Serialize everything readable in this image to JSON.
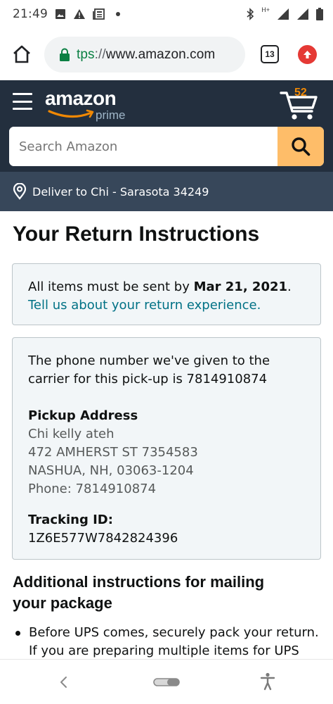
{
  "status_bar": {
    "time": "21:49",
    "left_icons": [
      "image-icon",
      "warning-icon",
      "news-icon",
      "dot-icon"
    ],
    "right_icons": [
      "bluetooth-icon",
      "hplus-signal-icon",
      "signal-icon",
      "battery-icon"
    ],
    "network_label": "H+"
  },
  "browser": {
    "url_scheme": "tps",
    "url_separator": "://",
    "url_host": "www.amazon.com",
    "tab_count": "13"
  },
  "amazon_header": {
    "logo_text": "amazon",
    "logo_sub": "prime",
    "cart_count": "52",
    "search_placeholder": "Search Amazon"
  },
  "deliver": {
    "text": "Deliver to Chi - Sarasota 34249"
  },
  "page": {
    "title": "Your Return Instructions",
    "deadline_prefix": "All items must be sent by ",
    "deadline_date": "Mar 21, 2021",
    "deadline_suffix": ".",
    "feedback_link": "Tell us about your return experience.",
    "phone_line1": "The phone number we've given to the",
    "phone_line2": "carrier for this pick-up is 7814910874",
    "pickup_label": "Pickup Address",
    "address_lines": [
      "Chi kelly ateh",
      "472 AMHERST ST 7354583",
      "NASHUA, NH, 03063-1204",
      "Phone: 7814910874"
    ],
    "tracking_label": "Tracking ID:",
    "tracking_id": "1Z6E577W7842824396",
    "section_line1": "Additional instructions for mailing",
    "section_line2": "your package",
    "bullet_lines": [
      "Before UPS comes, securely pack your return.",
      "If you are preparing multiple items for UPS"
    ]
  },
  "colors": {
    "header_bg": "#232f3e",
    "deliver_bg": "#37475a",
    "search_button": "#febd69",
    "link": "#007185",
    "cart_count": "#f08804",
    "box_bg": "#f2f6f8"
  }
}
